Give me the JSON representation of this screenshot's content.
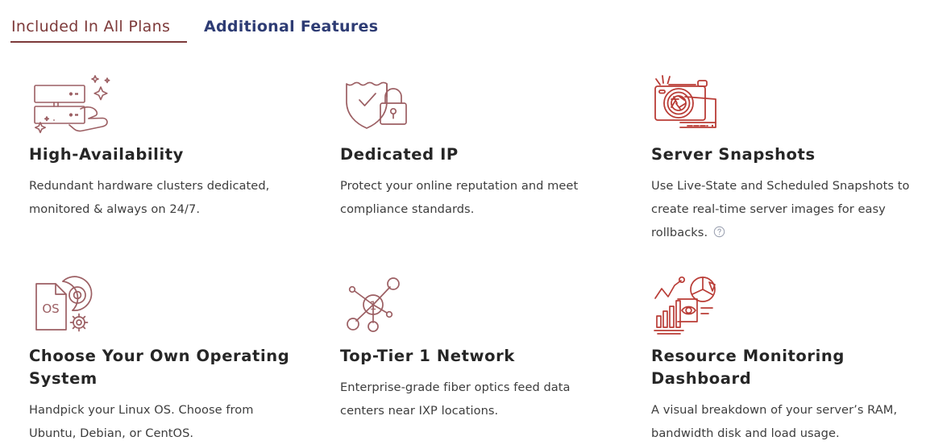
{
  "tabs": [
    {
      "label": "Included In All Plans",
      "active": true,
      "color": "#7d3a3a"
    },
    {
      "label": "Additional Features",
      "active": false,
      "color": "#2e3c74"
    }
  ],
  "features": [
    {
      "icon": "server-hand-icon",
      "title": "High-Availability",
      "description": "Redundant hardware clusters dedicated, monitored & always on 24/7.",
      "icon_color": "#9c5f63",
      "has_help": false
    },
    {
      "icon": "shield-lock-icon",
      "title": "Dedicated IP",
      "description": "Protect your online reputation and meet compliance standards.",
      "icon_color": "#9c5f63",
      "has_help": false
    },
    {
      "icon": "camera-icon",
      "title": "Server Snapshots",
      "description": "Use Live-State and Scheduled Snapshots to create real-time server images for easy rollbacks.",
      "icon_color": "#b93c36",
      "has_help": true,
      "help_label": "?"
    },
    {
      "icon": "os-disc-gear-icon",
      "title": "Choose Your Own Operating System",
      "description": "Handpick your Linux OS. Choose from Ubuntu, Debian, or CentOS.",
      "icon_color": "#9c5f63",
      "icon_text": "OS",
      "has_help": false
    },
    {
      "icon": "network-nodes-icon",
      "title": "Top-Tier 1 Network",
      "description": "Enterprise-grade fiber optics feed data centers near IXP locations.",
      "icon_color": "#9c5f63",
      "icon_text": "1",
      "has_help": false
    },
    {
      "icon": "monitoring-dashboard-icon",
      "title": "Resource Monitoring Dashboard",
      "description": "A visual breakdown of your server’s RAM, bandwidth disk and load usage.",
      "icon_color": "#b93c36",
      "has_help": false
    }
  ],
  "theme": {
    "background": "#ffffff",
    "title_color": "#262626",
    "body_color": "#3d3d3d",
    "accent_maroon": "#7d3a3a",
    "accent_navy": "#2e3c74",
    "help_icon_color": "#9aa0b0"
  }
}
